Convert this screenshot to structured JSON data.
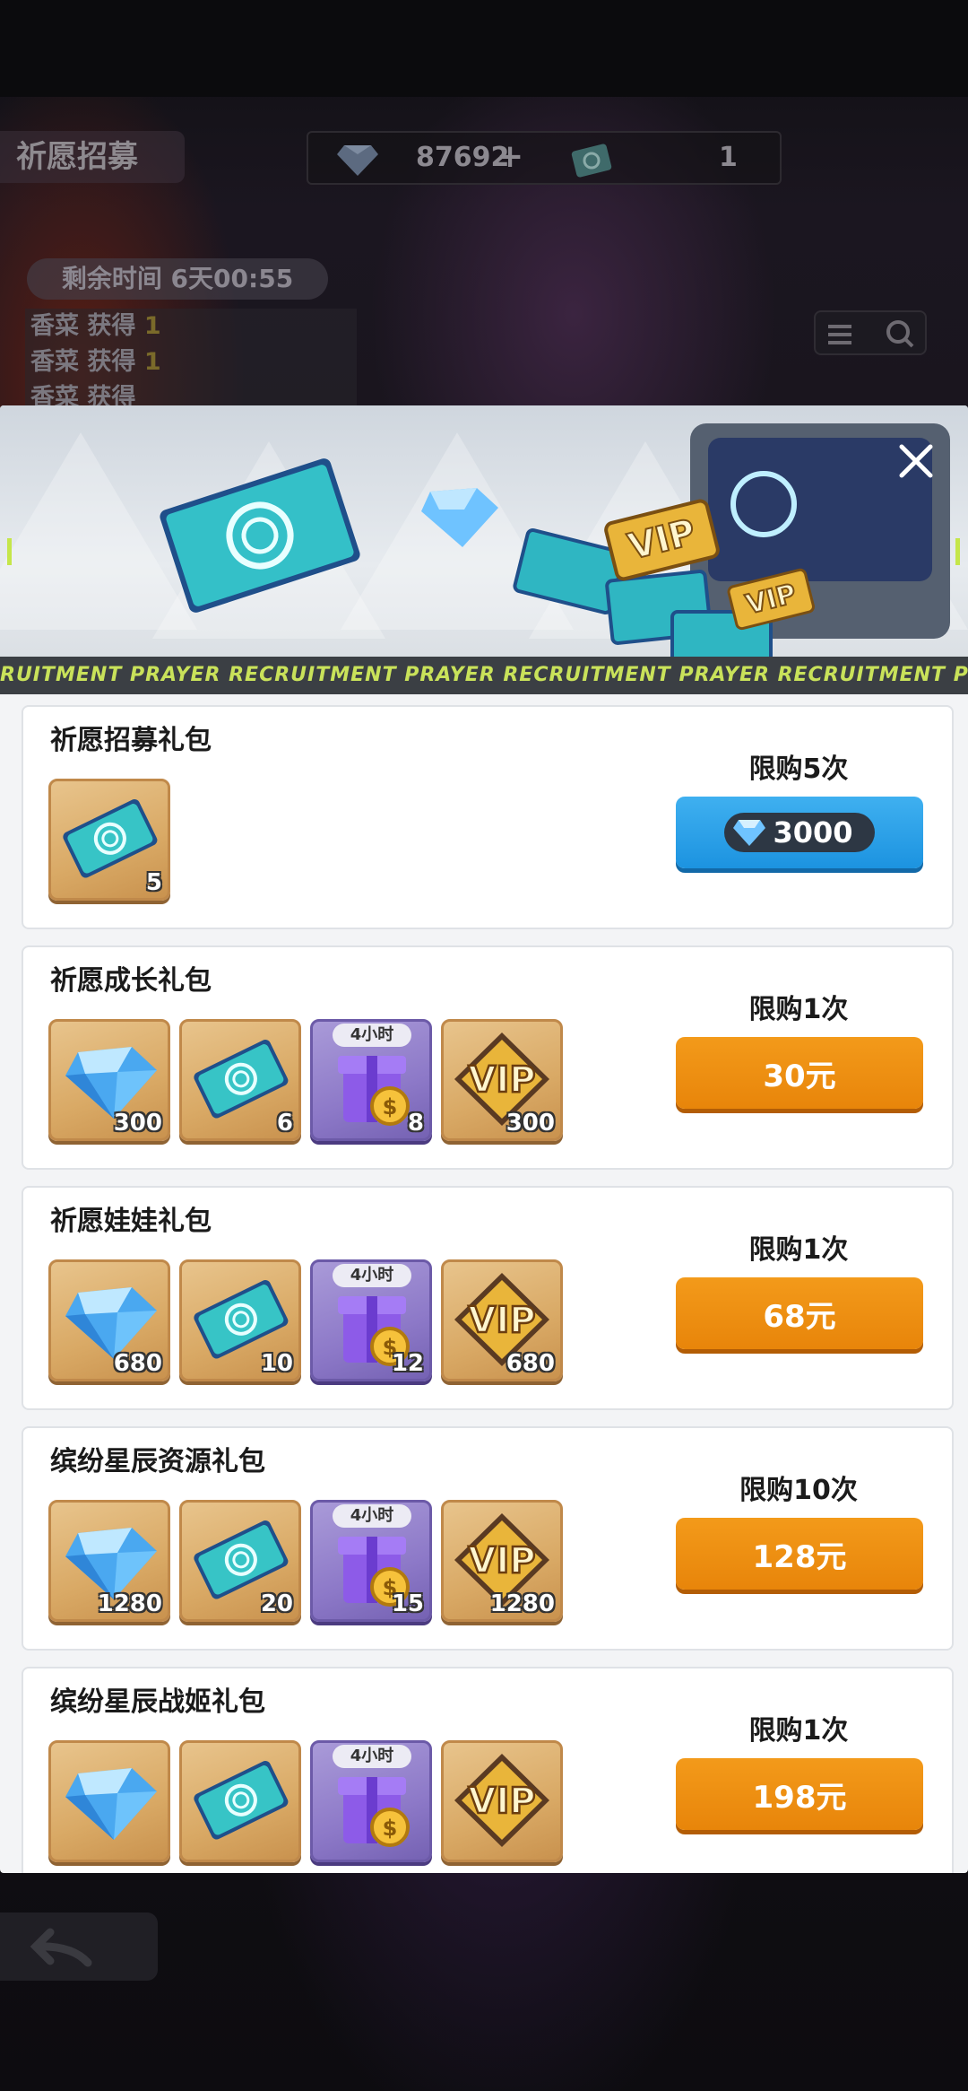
{
  "screen_header": {
    "title": "祈愿招募",
    "diamonds": "87692",
    "plus": "+",
    "tickets": "1",
    "remaining_time": "剩余时间 6天00:55"
  },
  "feed": [
    {
      "text": "香菜 获得",
      "count": "1"
    },
    {
      "text": "香菜 获得",
      "count": "1"
    },
    {
      "text": "香菜 获得",
      "count": ""
    }
  ],
  "banner": {
    "strip_text": "RUITMENT    PRAYER RECRUITMENT    PRAYER RECRUITMENT    PRAYER RECRUITMENT    PRAYER RECRUITMENT"
  },
  "packs": [
    {
      "title": "祈愿招募礼包",
      "limit": "限购5次",
      "button": "3000",
      "button_style": "diamond",
      "items": [
        {
          "kind": "ticket",
          "qty": "5"
        }
      ]
    },
    {
      "title": "祈愿成长礼包",
      "limit": "限购1次",
      "button": "30元",
      "button_style": "orange",
      "items": [
        {
          "kind": "diamond",
          "qty": "300"
        },
        {
          "kind": "ticket",
          "qty": "6"
        },
        {
          "kind": "giftbox",
          "qty": "8",
          "badge": "4小时"
        },
        {
          "kind": "vip",
          "qty": "300"
        }
      ]
    },
    {
      "title": "祈愿娃娃礼包",
      "limit": "限购1次",
      "button": "68元",
      "button_style": "orange",
      "items": [
        {
          "kind": "diamond",
          "qty": "680"
        },
        {
          "kind": "ticket",
          "qty": "10"
        },
        {
          "kind": "giftbox",
          "qty": "12",
          "badge": "4小时"
        },
        {
          "kind": "vip",
          "qty": "680"
        }
      ]
    },
    {
      "title": "缤纷星辰资源礼包",
      "limit": "限购10次",
      "button": "128元",
      "button_style": "orange",
      "items": [
        {
          "kind": "diamond",
          "qty": "1280"
        },
        {
          "kind": "ticket",
          "qty": "20"
        },
        {
          "kind": "giftbox",
          "qty": "15",
          "badge": "4小时"
        },
        {
          "kind": "vip",
          "qty": "1280"
        }
      ]
    },
    {
      "title": "缤纷星辰战姬礼包",
      "limit": "限购1次",
      "button": "198元",
      "button_style": "orange",
      "items": [
        {
          "kind": "diamond",
          "qty": ""
        },
        {
          "kind": "ticket",
          "qty": ""
        },
        {
          "kind": "giftbox",
          "qty": "",
          "badge": "4小时"
        },
        {
          "kind": "vip",
          "qty": ""
        }
      ]
    }
  ],
  "colors": {
    "buy_orange": "#e8850a",
    "buy_blue": "#1c93e0",
    "item_gold": "#d9a965",
    "item_purple": "#8d79c8",
    "strip_text": "#c9e25a"
  }
}
